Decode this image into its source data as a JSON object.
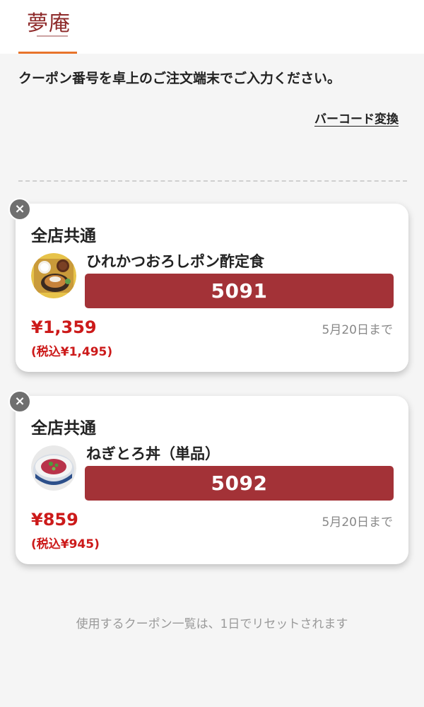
{
  "header": {
    "logo_text": "夢庵"
  },
  "instruction": "クーポン番号を卓上のご注文端末でご入力ください。",
  "barcode_link": "バーコード変換",
  "coupons": [
    {
      "category": "全店共通",
      "item": "ひれかつおろしポン酢定食",
      "code": "5091",
      "price": "¥1,359",
      "price_tax": "(税込¥1,495)",
      "expiry": "5月20日まで",
      "close_label": "×"
    },
    {
      "category": "全店共通",
      "item": "ねぎとろ丼（単品）",
      "code": "5092",
      "price": "¥859",
      "price_tax": "(税込¥945)",
      "expiry": "5月20日まで",
      "close_label": "×"
    }
  ],
  "footer_note": "使用するクーポン一覧は、1日でリセットされます",
  "colors": {
    "accent_orange": "#e8742b",
    "code_bg": "#a33237",
    "price_red": "#cc1a1a",
    "logo": "#8e2a2a"
  },
  "icons": {
    "close": "close-icon",
    "thumb1": "tonkatsu-set-meal-photo",
    "thumb2": "negitoro-bowl-photo"
  }
}
